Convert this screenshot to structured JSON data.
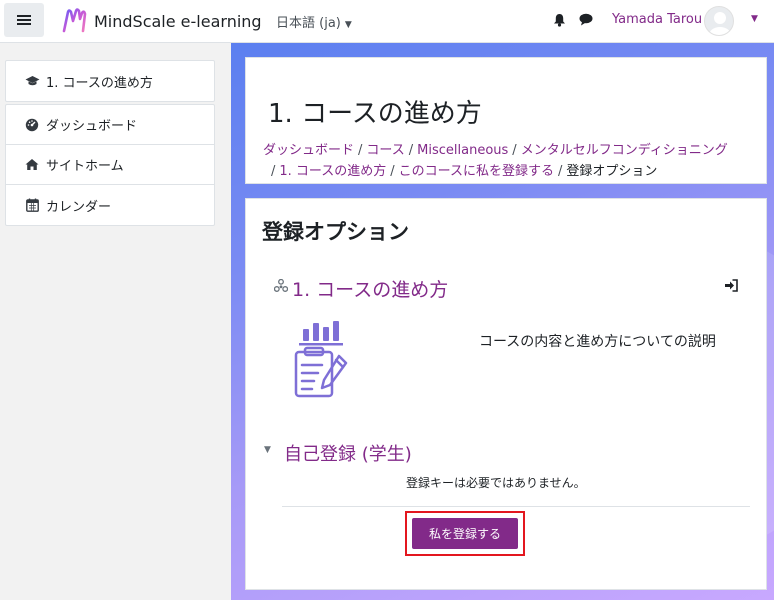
{
  "navbar": {
    "brand": "MindScale e-learning",
    "language": "日本語 (ja)",
    "username": "Yamada Tarou"
  },
  "drawer": {
    "course_item": "1. コースの進め方",
    "items": [
      {
        "label": "ダッシュボード",
        "icon": "dashboard-icon"
      },
      {
        "label": "サイトホーム",
        "icon": "home-icon"
      },
      {
        "label": "カレンダー",
        "icon": "calendar-icon"
      }
    ]
  },
  "header": {
    "title": "1. コースの進め方",
    "breadcrumb": [
      "ダッシュボード",
      "コース",
      "Miscellaneous",
      "メンタルセルフコンディショニング",
      "1. コースの進め方",
      "このコースに私を登録する"
    ],
    "breadcrumb_current": "登録オプション"
  },
  "content": {
    "section_title": "登録オプション",
    "course_name": "1. コースの進め方",
    "course_description": "コースの内容と進め方についての説明",
    "enrol_method": "自己登録 (学生)",
    "enrol_note": "登録キーは必要ではありません。",
    "enrol_button": "私を登録する"
  },
  "colors": {
    "accent": "#822a89",
    "highlight": "#e3171f"
  }
}
